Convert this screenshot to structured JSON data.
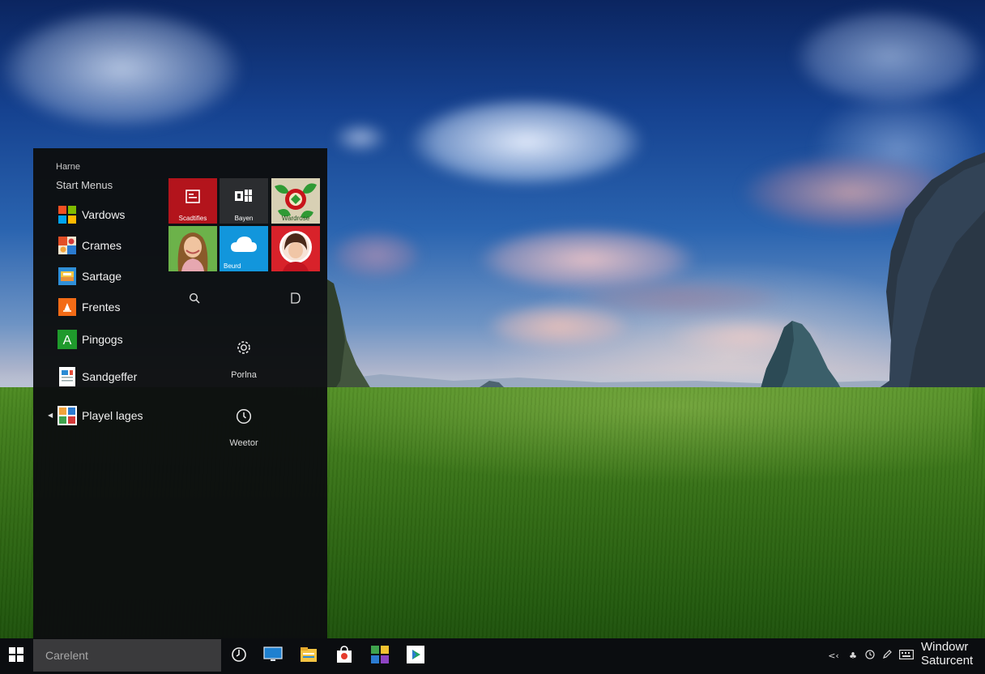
{
  "start_menu": {
    "header": "Harne",
    "subheader": "Start Menus",
    "apps": [
      {
        "label": "Vardows",
        "icon": "windows-logo-icon"
      },
      {
        "label": "Crames",
        "icon": "games-icon"
      },
      {
        "label": "Sartage",
        "icon": "storage-icon"
      },
      {
        "label": "Frentes",
        "icon": "frentes-icon"
      },
      {
        "label": "Pingogs",
        "icon": "letter-a-icon"
      },
      {
        "label": "Sandgeffer",
        "icon": "document-icon"
      },
      {
        "label": "Playel lages",
        "icon": "image-gallery-icon"
      }
    ],
    "tiles": [
      {
        "label": "Scadtifies",
        "color": "#b3141c",
        "icon": "reader-icon"
      },
      {
        "label": "Bayen",
        "color": "#2b2d30",
        "icon": "office-icon"
      },
      {
        "label": "Wardrose",
        "color": "#d8d0b4",
        "icon": "floral-emblem-icon"
      },
      {
        "label": "",
        "color": "#3d9e3c",
        "icon": "portrait-photo"
      },
      {
        "label": "Beurd",
        "color": "#1296dc",
        "icon": "cloud-icon"
      },
      {
        "label": "",
        "color": "#d8222a",
        "icon": "portrait-art"
      }
    ],
    "panel": {
      "power_label": "Porlna",
      "clock_label": "Weetor"
    }
  },
  "taskbar": {
    "search_placeholder": "Carelent",
    "pinned": [
      "timer-icon",
      "monitor-icon",
      "file-explorer-icon",
      "store-icon",
      "color-grid-icon",
      "media-player-icon"
    ],
    "tray": [
      "chevron-up-icon",
      "network-icon",
      "clock-icon",
      "pen-icon",
      "keyboard-icon"
    ],
    "clock_line1": "Windowr",
    "clock_line2": "Saturcent"
  }
}
